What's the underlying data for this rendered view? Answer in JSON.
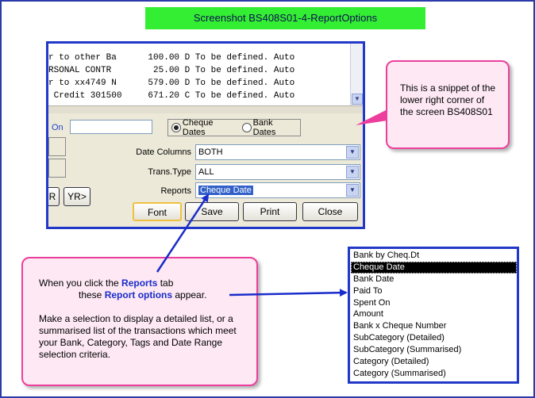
{
  "title": "Screenshot BS408S01-4-ReportOptions",
  "listing_rows": [
    "r to other Ba      100.00 D To be defined. Auto",
    "RSONAL CONTR        25.00 D To be defined. Auto",
    "r to xx4749 N      579.00 D To be defined. Auto",
    " Credit 301500     671.20 C To be defined. Auto"
  ],
  "form": {
    "on_label": "On",
    "radio_cheque": "Cheque Dates",
    "radio_bank": "Bank Dates",
    "date_columns_label": "Date Columns",
    "date_columns_value": "BOTH",
    "trans_type_label": "Trans.Type",
    "trans_type_value": "ALL",
    "reports_label": "Reports",
    "reports_value": "Cheque Date"
  },
  "buttons": {
    "r": "R",
    "yr": "YR>",
    "font": "Font",
    "save": "Save",
    "print": "Print",
    "close": "Close"
  },
  "callout_right": "This is a snippet of the lower right corner of the screen BS408S01",
  "callout_bottom": {
    "line1_pre": "When you click the ",
    "line1_link": "Reports",
    "line1_post": " tab",
    "line2_pre": "these ",
    "line2_link": "Report options",
    "line2_post": " appear.",
    "para2": "Make a selection to display a detailed list, or a summarised list of the transactions which meet your Bank, Category, Tags and Date Range selection criteria."
  },
  "report_options": [
    "Bank by Cheq.Dt",
    "Cheque Date",
    "Bank Date",
    "Paid To",
    "Spent On",
    "Amount",
    "Bank x Cheque Number",
    "SubCategory (Detailed)",
    "SubCategory (Summarised)",
    "Category (Detailed)",
    "Category (Summarised)"
  ],
  "selected_option_index": 1,
  "colors": {
    "banner": "#33ee33",
    "frame_border": "#2238c8",
    "callout_border": "#ec3f9d",
    "callout_bg": "#fde8f3",
    "accent_text": "#1a2ccc"
  }
}
